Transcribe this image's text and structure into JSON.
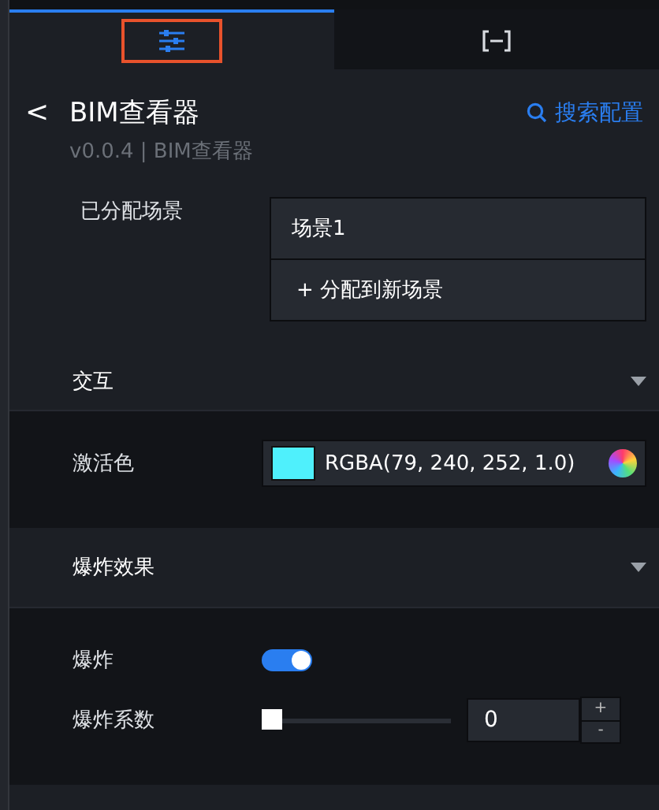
{
  "tabs": [
    {
      "kind": "sliders",
      "selected": true,
      "highlighted": true
    },
    {
      "kind": "brackets",
      "selected": false,
      "highlighted": false
    }
  ],
  "header": {
    "back": "<",
    "title": "BIM查看器",
    "search": "搜索配置",
    "subtitle": "v0.0.4 | BIM查看器"
  },
  "scenes": {
    "label": "已分配场景",
    "items": [
      "场景1"
    ],
    "add": "+ 分配到新场景"
  },
  "sections": [
    {
      "title": "交互",
      "expanded": true,
      "rows": [
        {
          "kind": "color",
          "label": "激活色",
          "color": "#4ff0fc",
          "value": "RGBA(79, 240, 252, 1.0)"
        }
      ]
    },
    {
      "title": "爆炸效果",
      "expanded": true,
      "rows": [
        {
          "kind": "toggle",
          "label": "爆炸",
          "on": true
        },
        {
          "kind": "slider",
          "label": "爆炸系数",
          "level": 0,
          "value": "0",
          "plus": "+",
          "minus": "-"
        }
      ]
    }
  ]
}
